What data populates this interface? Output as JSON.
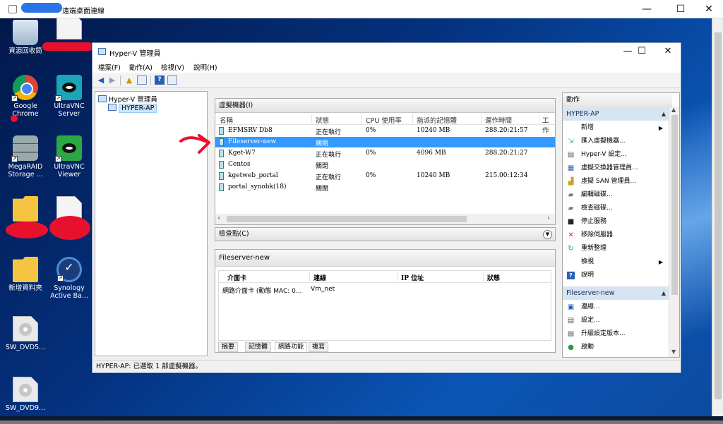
{
  "remote_window": {
    "title": "遠端桌面連線",
    "controls": {
      "minimize": "—",
      "maximize": "☐",
      "close": "✕"
    }
  },
  "desktop": {
    "icons": [
      {
        "label": "資源回收筒"
      },
      {
        "label": ""
      },
      {
        "label": "Google Chrome"
      },
      {
        "label": "UltraVNC Server"
      },
      {
        "label": "MegaRAID Storage ..."
      },
      {
        "label": "UltraVNC Viewer"
      },
      {
        "label": ""
      },
      {
        "label": ""
      },
      {
        "label": "新增資料夾"
      },
      {
        "label": "Synology Active Ba..."
      },
      {
        "label": "SW_DVD5..."
      },
      {
        "label": "SW_DVD9..."
      }
    ]
  },
  "hyperv": {
    "title": "Hyper-V 管理員",
    "controls": {
      "minimize": "—",
      "maximize": "☐",
      "close": "✕"
    },
    "menu": [
      "檔案(F)",
      "動作(A)",
      "檢視(V)",
      "說明(H)"
    ],
    "tree": {
      "root": "Hyper-V 管理員",
      "child": "HYPER-AP"
    },
    "vm_panel": {
      "title": "虛擬機器(I)",
      "columns": [
        "名稱",
        "狀態",
        "CPU 使用率",
        "指派的記憶體",
        "運作時間",
        "工作"
      ],
      "rows": [
        {
          "name": "EFMSRV Db8",
          "state": "正在執行",
          "cpu": "0%",
          "memory": "10240 MB",
          "uptime": "288.20:21:57"
        },
        {
          "name": "Fileserver-new",
          "state": "關閉",
          "cpu": "",
          "memory": "",
          "uptime": ""
        },
        {
          "name": "Kget-W7",
          "state": "正在執行",
          "cpu": "0%",
          "memory": "4096 MB",
          "uptime": "288.20:21:27"
        },
        {
          "name": "Centos",
          "state": "關閉",
          "cpu": "",
          "memory": "",
          "uptime": ""
        },
        {
          "name": "kgetweb_portal",
          "state": "正在執行",
          "cpu": "0%",
          "memory": "10240 MB",
          "uptime": "215.00:12:34"
        },
        {
          "name": "portal_synobk(18)",
          "state": "關閉",
          "cpu": "",
          "memory": "",
          "uptime": ""
        }
      ],
      "selected_row": 1
    },
    "checkpoints": {
      "title": "檢查點(C)"
    },
    "details": {
      "title": "Fileserver-new",
      "columns": [
        "介面卡",
        "連線",
        "IP 位址",
        "狀態"
      ],
      "row": {
        "adapter": "網路介面卡 (動態 MAC: 0...",
        "connection": "Vm_net",
        "ip": "",
        "state": ""
      },
      "tabs": [
        "摘要",
        "記憶體",
        "網路功能",
        "複寫"
      ],
      "active_tab": 2
    },
    "actions": {
      "title": "動作",
      "host_section": "HYPER-AP",
      "host_items": [
        "新增",
        "匯入虛擬機器...",
        "Hyper-V 設定...",
        "虛擬交換器管理員...",
        "虛擬 SAN 管理員...",
        "編輯磁碟...",
        "檢查磁碟...",
        "停止服務",
        "移除伺服器",
        "重新整理",
        "檢視",
        "說明"
      ],
      "vm_section": "Fileserver-new",
      "vm_items": [
        "連線...",
        "設定...",
        "升級設定版本...",
        "啟動"
      ]
    },
    "status": "HYPER-AP:  已選取 1 部虛擬機器。"
  }
}
